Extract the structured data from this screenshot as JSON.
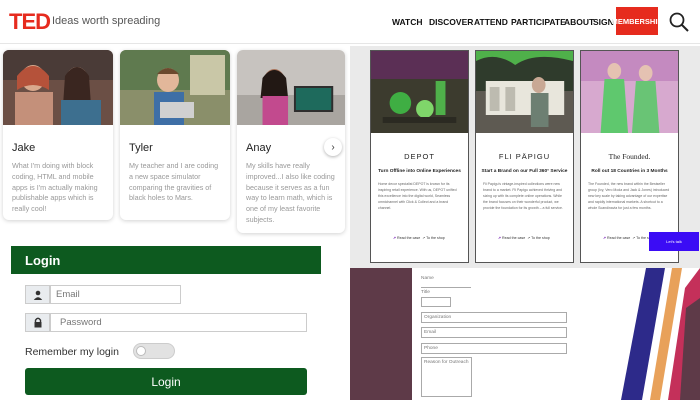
{
  "header": {
    "logo": "TED",
    "tagline": "Ideas worth spreading",
    "nav": [
      "WATCH",
      "DISCOVER",
      "ATTEND",
      "PARTICIPATE",
      "ABOUT",
      "SIGN IN"
    ],
    "membership_label": "MEMBERSHIP",
    "search_icon": "search-icon"
  },
  "cards": [
    {
      "name": "Jake",
      "desc": "What I'm doing with block coding, HTML and mobile apps is I'm actually making publishable apps which is really cool!"
    },
    {
      "name": "Tyler",
      "desc": "My teacher and I are coding a new space simulator comparing the gravities of black holes to Mars."
    },
    {
      "name": "Anay",
      "desc": "My skills have really improved...I also like coding because it serves as a fun way to learn math, which is one of my least favorite subjects."
    }
  ],
  "carousel": {
    "next_icon": "chevron-right-icon"
  },
  "showcase": [
    {
      "title": "DEPOT",
      "subtitle": "Turn Offline into Online Experiences",
      "body": "Home decor specialist DEPOT is known for its inspiring retail experience. With us, DEPOT unified this excellence into the digital world, Seamless omnichannel with Click & Collect and a brand channel.",
      "read": "Read the case",
      "shop": "To the shop"
    },
    {
      "title": "FLI PÄPIGU",
      "subtitle": "Start a Brand on our Full 360° Service",
      "body": "Fli Papigu's vintage-inspired collections were new brand to a market. Fli Papigu achieved thriving and sizing up with its complete online operations. While the brand focuses on their wonderful product, we provide the foundation for its growth – a full service.",
      "read": "Read the case",
      "shop": "To the shop"
    },
    {
      "title": "The Founded.",
      "subtitle": "Roll out 18 Countries in 3 Months",
      "body": "The Founded, the new brand within the Bestseller group (Ivy, Vero Moda and Jack & Jones) introduced new key scale by taking advantage of our expertise and rapidly international markets. A shortcut to a whole Scandinavia for just a few months.",
      "read": "Read the case",
      "shop": "To the shop"
    }
  ],
  "showcase_button": "Let's talk",
  "login": {
    "title": "Login",
    "email_placeholder": "Email",
    "password_placeholder": "Password",
    "remember_label": "Remember my login",
    "button_label": "Login",
    "user_icon": "user-icon",
    "lock_icon": "lock-icon"
  },
  "form_panel": {
    "labels": [
      "Name",
      "Title",
      "Organization",
      "Email",
      "Phone",
      "Reason for Outreach"
    ]
  }
}
